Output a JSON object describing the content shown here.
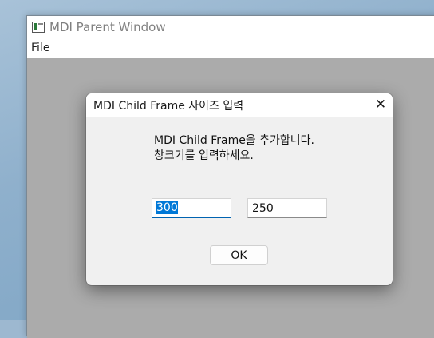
{
  "parent_window": {
    "title": "MDI Parent Window",
    "icon": "app-window-icon",
    "menu": {
      "file_label": "File"
    }
  },
  "dialog": {
    "title": "MDI Child Frame 사이즈 입력",
    "close_glyph": "✕",
    "message_line1": "MDI Child Frame을 추가합니다.",
    "message_line2": "창크기를 입력하세요.",
    "width_value": "300",
    "height_value": "250",
    "ok_label": "OK"
  },
  "colors": {
    "mdi_client_background": "#ababab",
    "dialog_background": "#f0f0f0",
    "focus_accent": "#0078d7"
  }
}
